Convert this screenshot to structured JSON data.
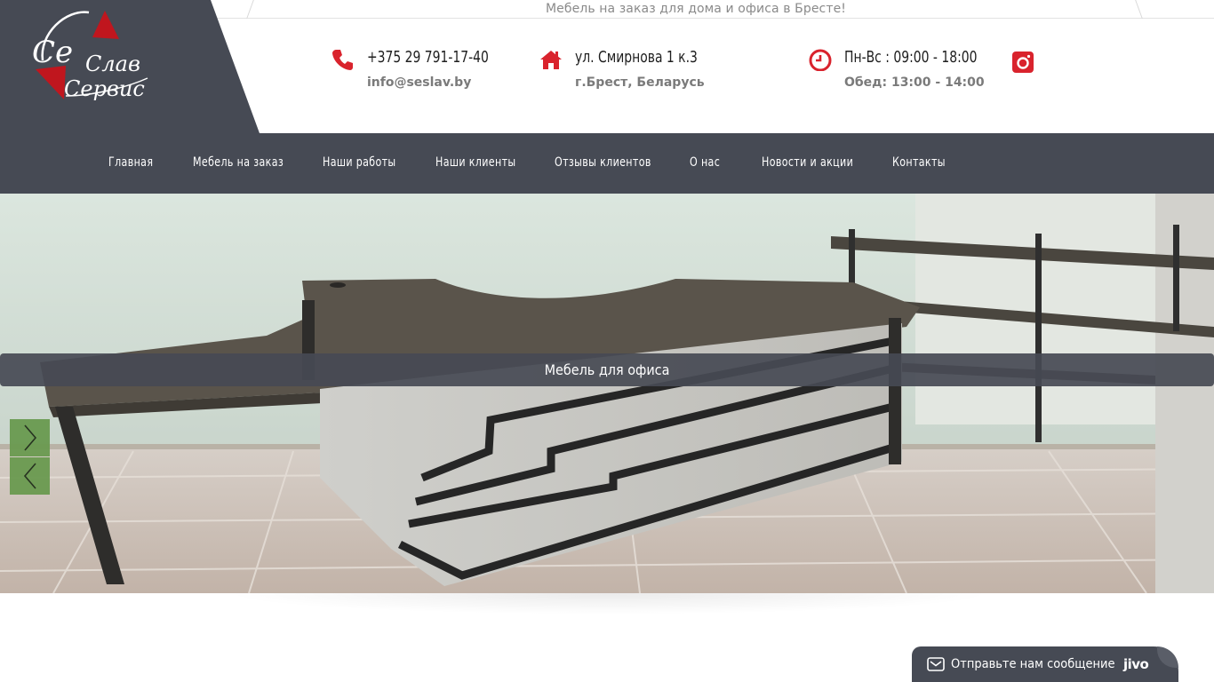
{
  "header": {
    "tagline": "Мебель на заказ для дома и офиса в Бресте!",
    "logo": {
      "line1": "Се",
      "line2": "Слав",
      "line3": "Сервис",
      "accent_color": "#c0161e"
    },
    "contacts": {
      "phone": "+375 29 791-17-40",
      "email": "info@seslav.by",
      "address": "ул. Смирнова 1 к.3",
      "city": "г.Брест, Беларусь",
      "hours": "Пн-Вс : 09:00 - 18:00",
      "lunch": "Обед: 13:00 - 14:00"
    },
    "icons": {
      "phone": "phone-icon",
      "address": "home-icon",
      "hours": "clock-icon",
      "social": "instagram-icon"
    },
    "icon_color": "#d9232d"
  },
  "nav": {
    "items": [
      {
        "label": "Главная"
      },
      {
        "label": "Мебель на заказ"
      },
      {
        "label": "Наши работы"
      },
      {
        "label": "Наши клиенты"
      },
      {
        "label": "Отзывы клиентов"
      },
      {
        "label": "О нас"
      },
      {
        "label": "Новости и акции"
      },
      {
        "label": "Контакты"
      }
    ],
    "background": "#464a54"
  },
  "slider": {
    "caption": "Мебель для офиса",
    "next_icon": "chevron-right-icon",
    "prev_icon": "chevron-left-icon",
    "button_color": "#6a9a50"
  },
  "chat_widget": {
    "label": "Отправьте нам сообщение",
    "brand": "jivo",
    "icon": "mail-icon"
  }
}
